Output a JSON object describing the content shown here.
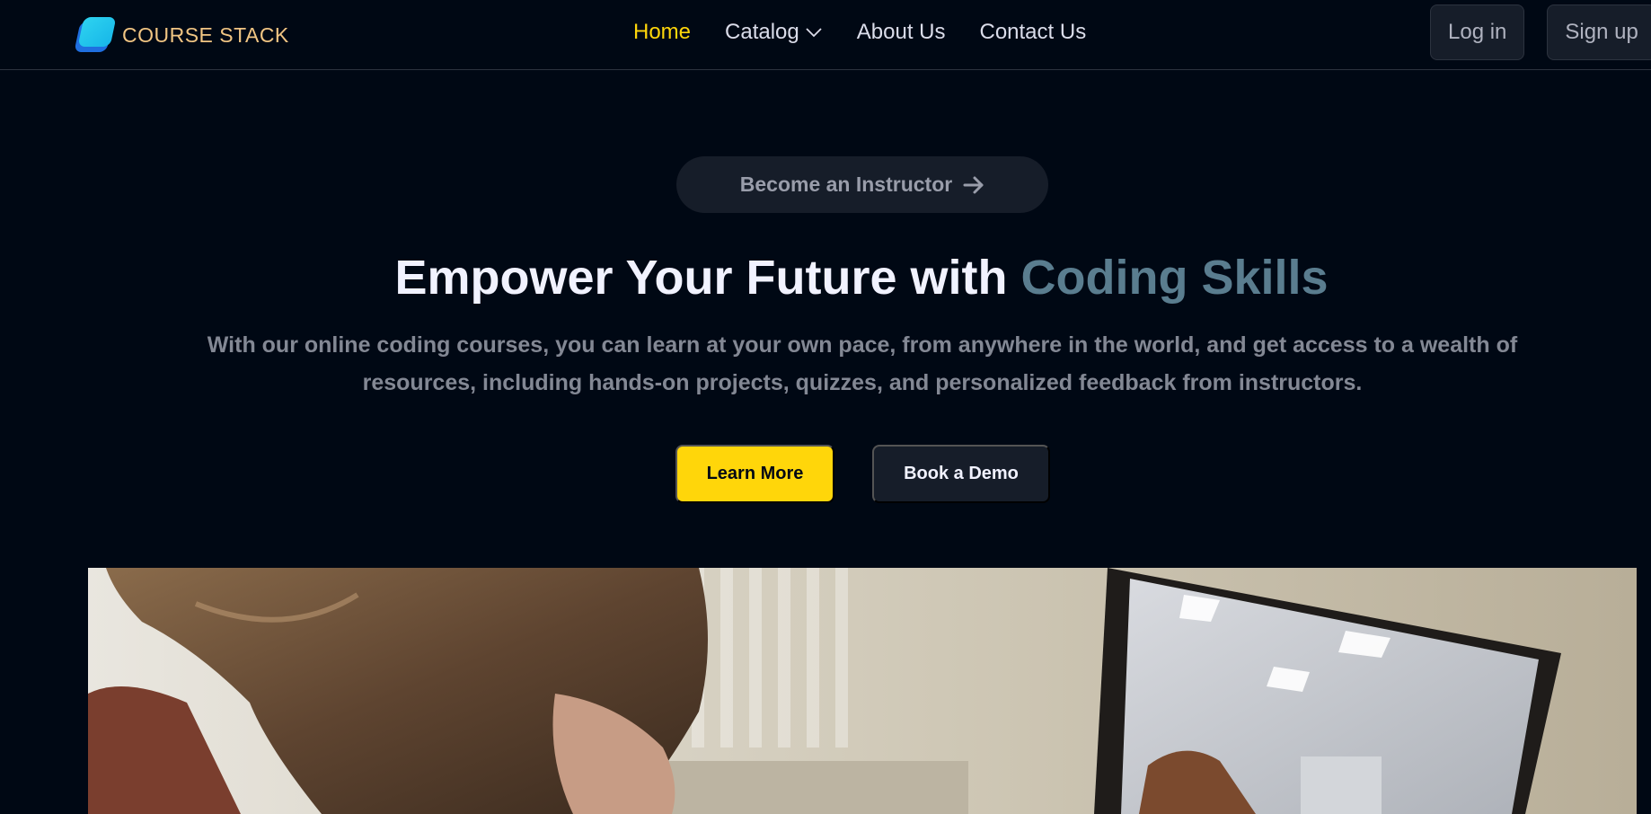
{
  "brand": {
    "name": "COURSE STACK"
  },
  "nav": {
    "links": [
      {
        "label": "Home",
        "active": true
      },
      {
        "label": "Catalog",
        "has_dropdown": true
      },
      {
        "label": "About Us"
      },
      {
        "label": "Contact Us"
      }
    ]
  },
  "auth": {
    "login_label": "Log in",
    "signup_label": "Sign up"
  },
  "hero": {
    "instructor_cta": "Become an Instructor",
    "title_main": "Empower Your Future with ",
    "title_highlight": "Coding Skills",
    "subtitle_line1": "With our online coding courses, you can learn at your own pace, from anywhere in the world, and get access to a wealth of",
    "subtitle_line2": "resources, including hands-on projects, quizzes, and personalized feedback from instructors.",
    "primary_cta": "Learn More",
    "secondary_cta": "Book a Demo"
  },
  "colors": {
    "background": "#000814",
    "accent_yellow": "#ffd60a",
    "highlight_teal": "#5a7d8f",
    "surface": "#161d29"
  },
  "icons": {
    "dropdown": "chevron-down-icon",
    "instructor_arrow": "arrow-right-icon"
  }
}
